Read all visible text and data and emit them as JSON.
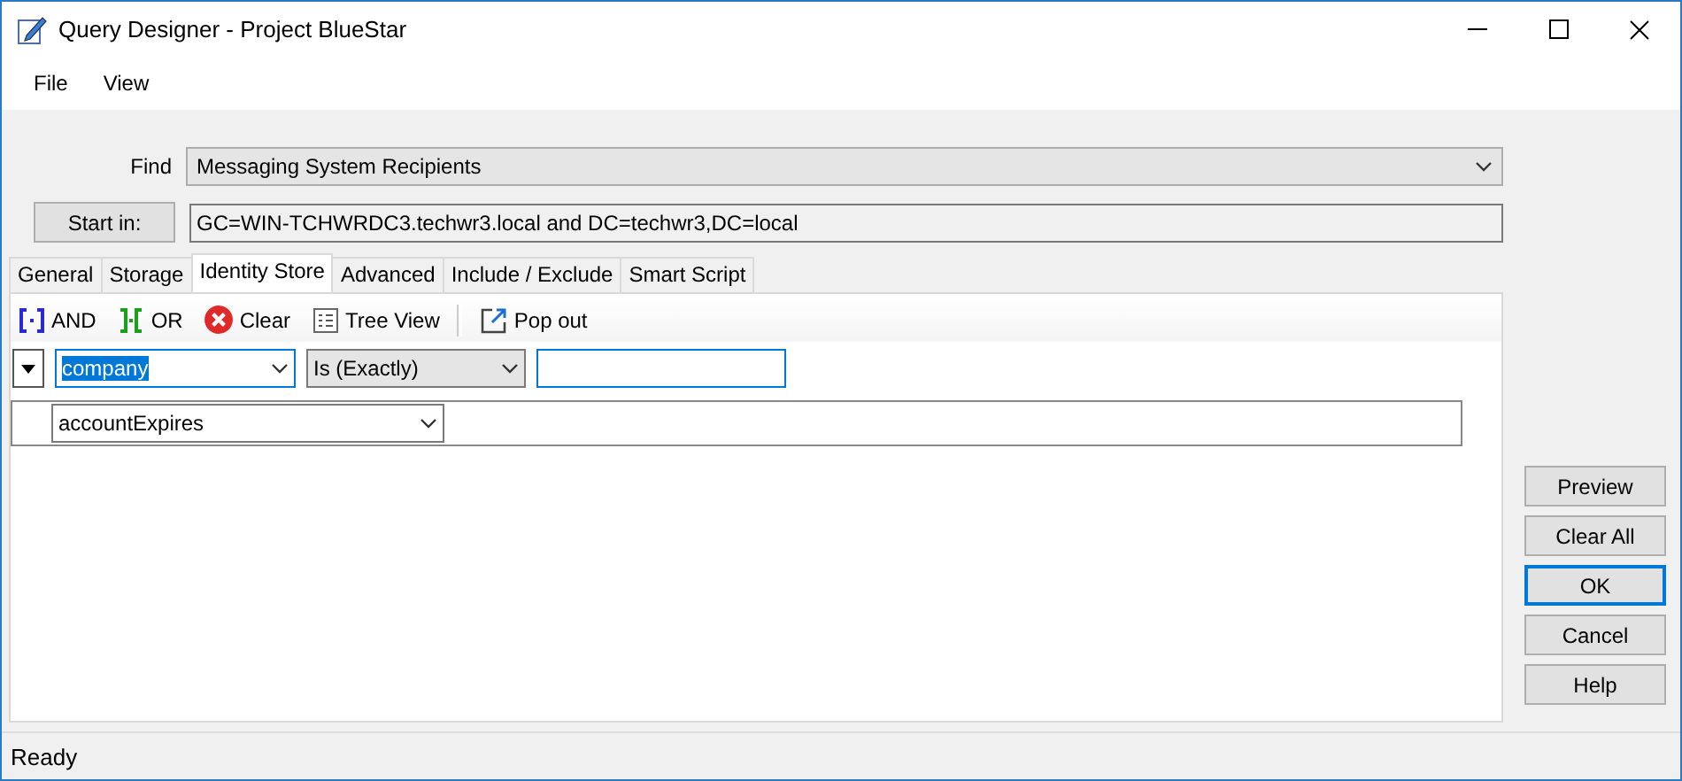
{
  "window": {
    "title": "Query Designer - Project BlueStar"
  },
  "menu": [
    "File",
    "View"
  ],
  "find": {
    "label": "Find",
    "value": "Messaging System Recipients"
  },
  "start_in": {
    "button": "Start in:",
    "value": "GC=WIN-TCHWRDC3.techwr3.local and DC=techwr3,DC=local"
  },
  "tabs": [
    {
      "label": "General",
      "selected": false
    },
    {
      "label": "Storage",
      "selected": false
    },
    {
      "label": "Identity Store",
      "selected": true
    },
    {
      "label": "Advanced",
      "selected": false
    },
    {
      "label": "Include / Exclude",
      "selected": false
    },
    {
      "label": "Smart Script",
      "selected": false
    }
  ],
  "toolbar": [
    {
      "kind": "and",
      "label": "AND"
    },
    {
      "kind": "or",
      "label": "OR"
    },
    {
      "kind": "clear",
      "label": "Clear"
    },
    {
      "kind": "tree",
      "label": "Tree View"
    },
    {
      "kind": "popout",
      "label": "Pop out"
    }
  ],
  "criteria": [
    {
      "kind": "condition",
      "attribute": "company",
      "attribute_selected": true,
      "operator": "Is (Exactly)"
    },
    {
      "kind": "attribute",
      "attribute": "accountExpires",
      "attribute_selected": false
    }
  ],
  "buttons": [
    {
      "label": "Preview",
      "default": false
    },
    {
      "label": "Clear All",
      "default": false
    },
    {
      "label": "OK",
      "default": true
    },
    {
      "label": "Cancel",
      "default": false
    },
    {
      "label": "Help",
      "default": false
    }
  ],
  "status_bar": "Ready"
}
